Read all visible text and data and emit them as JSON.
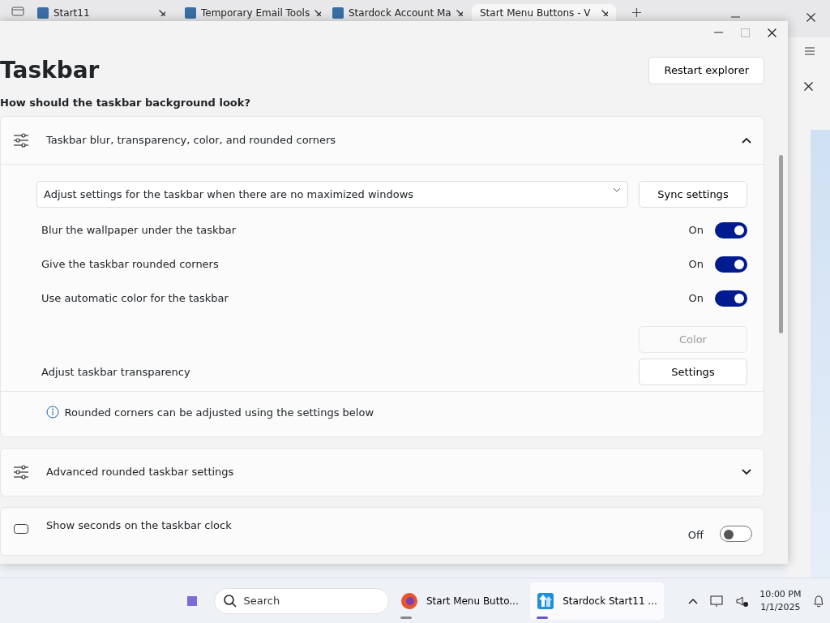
{
  "browser": {
    "tabs": [
      {
        "label": "Start11",
        "selected": false
      },
      {
        "label": "Temporary Email Tools",
        "selected": false
      },
      {
        "label": "Stardock Account Ma",
        "selected": false
      },
      {
        "label": "Start Menu Buttons - V",
        "selected": true
      }
    ]
  },
  "window": {
    "title": "Taskbar",
    "restart_button": "Restart explorer",
    "question": "How should the taskbar background look?",
    "sections": [
      {
        "title": "Taskbar blur, transparency, color, and rounded corners",
        "expanded": true,
        "dropdown": "Adjust settings for the taskbar when there are no maximized windows",
        "sync_button": "Sync settings",
        "toggles": [
          {
            "label": "Blur the wallpaper under the taskbar",
            "state_text": "On",
            "on": true
          },
          {
            "label": "Give the taskbar rounded corners",
            "state_text": "On",
            "on": true
          },
          {
            "label": "Use automatic color for the taskbar",
            "state_text": "On",
            "on": true
          }
        ],
        "color_button": {
          "label": "Color",
          "disabled": true
        },
        "transparency": {
          "label": "Adjust taskbar transparency",
          "button": "Settings"
        },
        "info": "Rounded corners can be adjusted using the settings below"
      },
      {
        "title": "Advanced rounded taskbar settings",
        "expanded": false
      }
    ],
    "clock_row": {
      "label": "Show seconds on the taskbar clock",
      "state_text": "Off",
      "on": false
    }
  },
  "taskbar": {
    "search_placeholder": "Search",
    "apps": [
      {
        "label": "Start Menu Butto...",
        "selected": false
      },
      {
        "label": "Stardock Start11 ...",
        "selected": true
      }
    ],
    "time": "10:00 PM",
    "date": "1/1/2025"
  }
}
